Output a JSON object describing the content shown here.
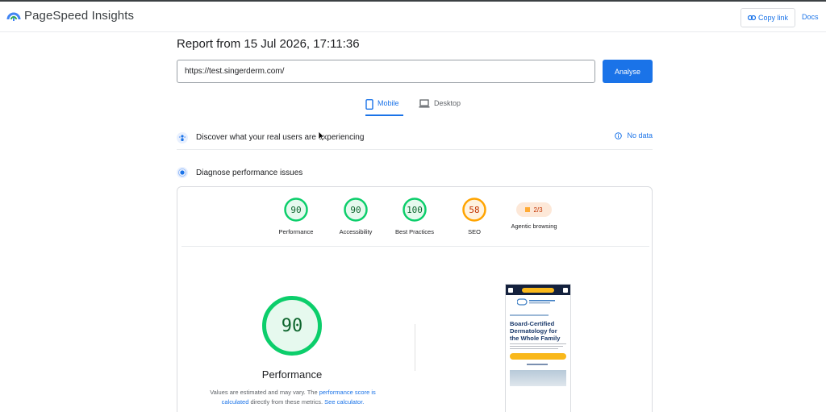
{
  "app": {
    "title": "PageSpeed Insights",
    "copy_link_label": "Copy link",
    "docs_label": "Docs"
  },
  "report": {
    "title": "Report from 15 Jul 2026, 17:11:36",
    "url_value": "https://test.singerderm.com/",
    "analyse_label": "Analyse"
  },
  "tabs": [
    {
      "label": "Mobile",
      "selected": true
    },
    {
      "label": "Desktop",
      "selected": false
    }
  ],
  "crux": {
    "title": "Discover what your real users are experiencing",
    "status": "No data"
  },
  "diagnose": {
    "title": "Diagnose performance issues"
  },
  "scores": [
    {
      "label": "Performance",
      "value": 90
    },
    {
      "label": "Accessibility",
      "value": 90
    },
    {
      "label": "Best Practices",
      "value": 100
    },
    {
      "label": "SEO",
      "value": 58
    }
  ],
  "agentic": {
    "label": "Agentic browsing",
    "value": "2/3"
  },
  "performance": {
    "score": 90,
    "label": "Performance",
    "note_prefix": "Values are estimated and may vary. The ",
    "note_link1": "performance score is calculated",
    "note_mid": " directly from these metrics. ",
    "note_link2": "See calculator."
  },
  "screenshot": {
    "headline": "Board-Certified Dermatology for the Whole Family"
  },
  "colors": {
    "accent": "#1a73e8",
    "pass": "#0cce6b",
    "average": "#ffa400"
  },
  "icons": {
    "logo": "pagespeed-logo-icon",
    "copy": "link-icon",
    "mobile": "phone-icon",
    "desktop": "laptop-icon",
    "crux": "users-icon",
    "diagnose": "lab-icon",
    "info": "info-icon"
  }
}
